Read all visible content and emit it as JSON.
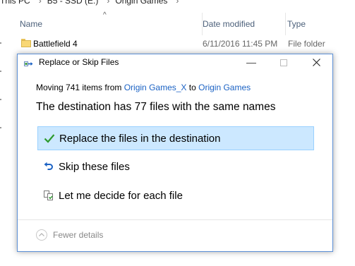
{
  "explorer": {
    "breadcrumb": [
      "This PC",
      "B5 - SSD (E:)",
      "Origin Games"
    ],
    "columns": {
      "name": "Name",
      "date": "Date modified",
      "type": "Type"
    },
    "rows": [
      {
        "name": "Battlefield 4",
        "date": "6/11/2016 11:45 PM",
        "type": "File folder"
      }
    ]
  },
  "dialog": {
    "title": "Replace or Skip Files",
    "moving": {
      "prefix": "Moving 741 items from ",
      "from": "Origin Games_X",
      "mid": " to ",
      "to": "Origin Games"
    },
    "headline": "The destination has 77 files with the same names",
    "options": {
      "replace": "Replace the files in the destination",
      "skip": "Skip these files",
      "decide": "Let me decide for each file"
    },
    "footer": {
      "fewer_details": "Fewer details"
    },
    "icons": {
      "title": "file-move-icon",
      "replace": "checkmark-icon",
      "skip": "skip-arrow-icon",
      "decide": "compare-files-icon"
    },
    "colors": {
      "link": "#1b62c4",
      "selection": "#cce8ff",
      "check": "#2d9a2d",
      "skip": "#1b62c4"
    }
  }
}
